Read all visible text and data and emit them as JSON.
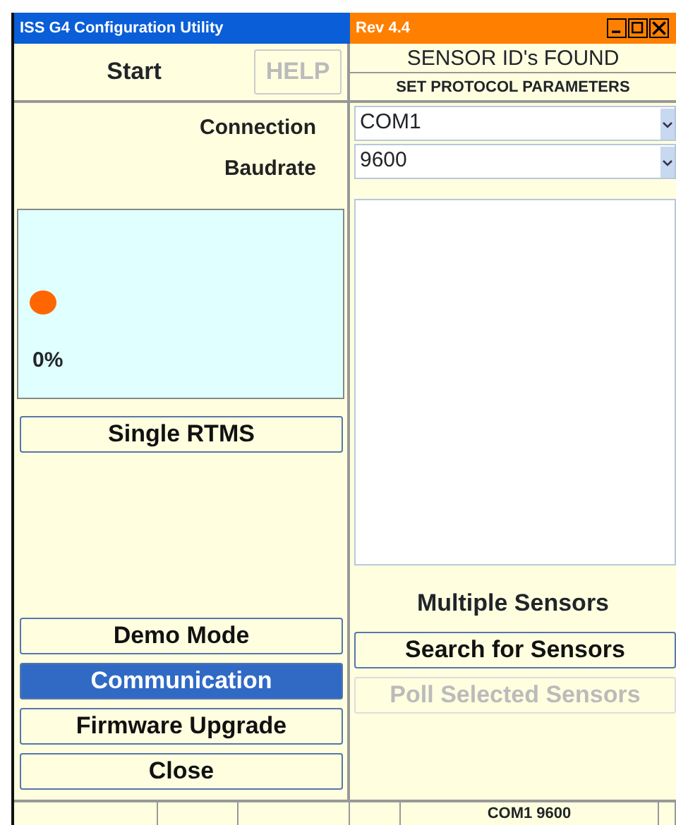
{
  "window": {
    "title": "ISS G4 Configuration Utility",
    "revision": "Rev 4.4"
  },
  "start": {
    "label": "Start",
    "help_button": {
      "label": "HELP",
      "disabled": true
    }
  },
  "right_header": {
    "title": "SENSOR ID's FOUND",
    "subtitle": "SET PROTOCOL PARAMETERS"
  },
  "fields": [
    {
      "label": "Connection",
      "value": "COM1"
    },
    {
      "label": "Baudrate",
      "value": "9600"
    }
  ],
  "status_panel": {
    "color": "#ff6600",
    "percent": "0%"
  },
  "single_button": {
    "label": "Single RTMS",
    "disabled": false
  },
  "sensor_list_title": "Multiple Sensors",
  "left_buttons": [
    {
      "label": "Demo Mode",
      "selected": false
    },
    {
      "label": "Communication",
      "selected": true
    },
    {
      "label": "Firmware Upgrade",
      "selected": false
    },
    {
      "label": "Close",
      "selected": false
    }
  ],
  "right_buttons": [
    {
      "label": "Search for Sensors",
      "disabled": false
    },
    {
      "label": "Poll Selected Sensors",
      "disabled": true
    }
  ],
  "status_bar": {
    "text": "COM1 9600"
  }
}
